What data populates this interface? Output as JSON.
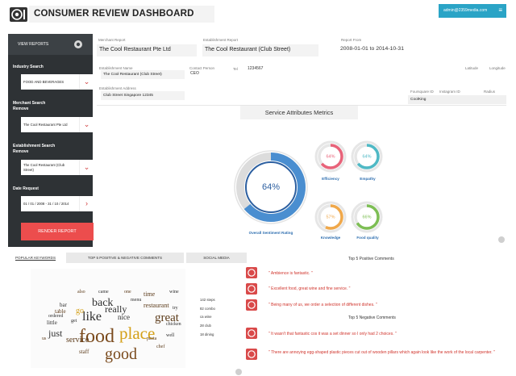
{
  "header": {
    "title": "CONSUMER REVIEW DASHBOARD",
    "user": "admin@2359media.com"
  },
  "sidebar": {
    "section_label": "VIEW REPORTS",
    "industry_label": "Industry Search",
    "industry_value": "FOOD AND BEVERAGES",
    "merchant_label_1": "Merchant Search",
    "merchant_label_2": "Remove",
    "merchant_value": "The Cool Restaurant Pte Ltd",
    "establishment_label_1": "Establishment Search",
    "establishment_label_2": "Remove",
    "establishment_value_1": "The Cool Restaurant (Club",
    "establishment_value_2": "Street)",
    "date_label": "Date Request",
    "date_value": "01 / 01 / 2008 - 31 / 10 / 2014",
    "render_button": "RENDER REPORT"
  },
  "info": {
    "merchant_report_label": "Merchant Report",
    "merchant_report_value": "The Cool Restaurant Pte Ltd",
    "establishment_report_label": "Establishment Report",
    "establishment_report_value": "The Cool Restaurant (Club Street)",
    "report_from_label": "Report From",
    "report_from_value": "2008-01-01 to 2014-10-31",
    "establishment_name_label": "Establishment Name",
    "establishment_name_value": "The Cool Restaurant (Club Street)",
    "contact_person_label": "Contact Person",
    "contact_person_value": "CEO",
    "tel_label": "Tel",
    "tel_value": "1234567",
    "latitude_label": "Latitude",
    "longitude_label": "Longitude",
    "address_label": "Establishment Address",
    "address_value": "Club Street Singapore 12345",
    "foursquare_label": "Foursquare ID",
    "instagram_label": "Instagram ID",
    "radius_label": "Radius",
    "foursquare_value": "CoolKing"
  },
  "service": {
    "title": "Service Attributes Metrics",
    "overall_label": "Overall Sentiment Rating",
    "overall_value": "64%",
    "overall_pct": 64,
    "gauges": [
      {
        "label": "Efficiency",
        "value": "64%",
        "pct": 64,
        "color": "#e8637a"
      },
      {
        "label": "Empathy",
        "value": "64%",
        "pct": 64,
        "color": "#4fb9c5"
      },
      {
        "label": "Knowledge",
        "value": "57%",
        "pct": 57,
        "color": "#f0a84a"
      },
      {
        "label": "Food quality",
        "value": "66%",
        "pct": 66,
        "color": "#7dbe54"
      }
    ]
  },
  "tabs": [
    {
      "label": "POPULAR KEYWORDS"
    },
    {
      "label": "TOP 5 POSITIVE & NEGATIVE COMMENTS"
    },
    {
      "label": "SOCIAL MEDIA"
    }
  ],
  "wordcloud": {
    "words": [
      "food",
      "place",
      "good",
      "great",
      "back",
      "like",
      "service",
      "just",
      "really",
      "restaurant",
      "nice",
      "time",
      "little",
      "go",
      "table",
      "bar",
      "staff",
      "ordered",
      "menu",
      "also",
      "try",
      "one",
      "well",
      "us",
      "get",
      "pasta",
      "chicken",
      "came",
      "chef",
      "wine"
    ]
  },
  "terms": [
    {
      "text": "142 steps"
    },
    {
      "text": "82 combo"
    },
    {
      "text": "ca wine"
    },
    {
      "text": "28 club"
    },
    {
      "text": "18 dining"
    }
  ],
  "comments": {
    "positive_header": "Top 5 Positive Comments",
    "negative_header": "Top 5 Negative Comments",
    "positive": [
      "\" Ambience is fantastic. \"",
      "\" Excellent food, great wine and fine service. \"",
      "\" Being many of us, we order a selection of different dishes. \""
    ],
    "negative": [
      "\" It wasn't that fantastic cos it was a set dinner so I only had 2 choices. \"",
      "\" There are annoying egg-shaped plastic pieces cut out of wooden pillars which again look like the work of the local carpenter. \""
    ]
  }
}
